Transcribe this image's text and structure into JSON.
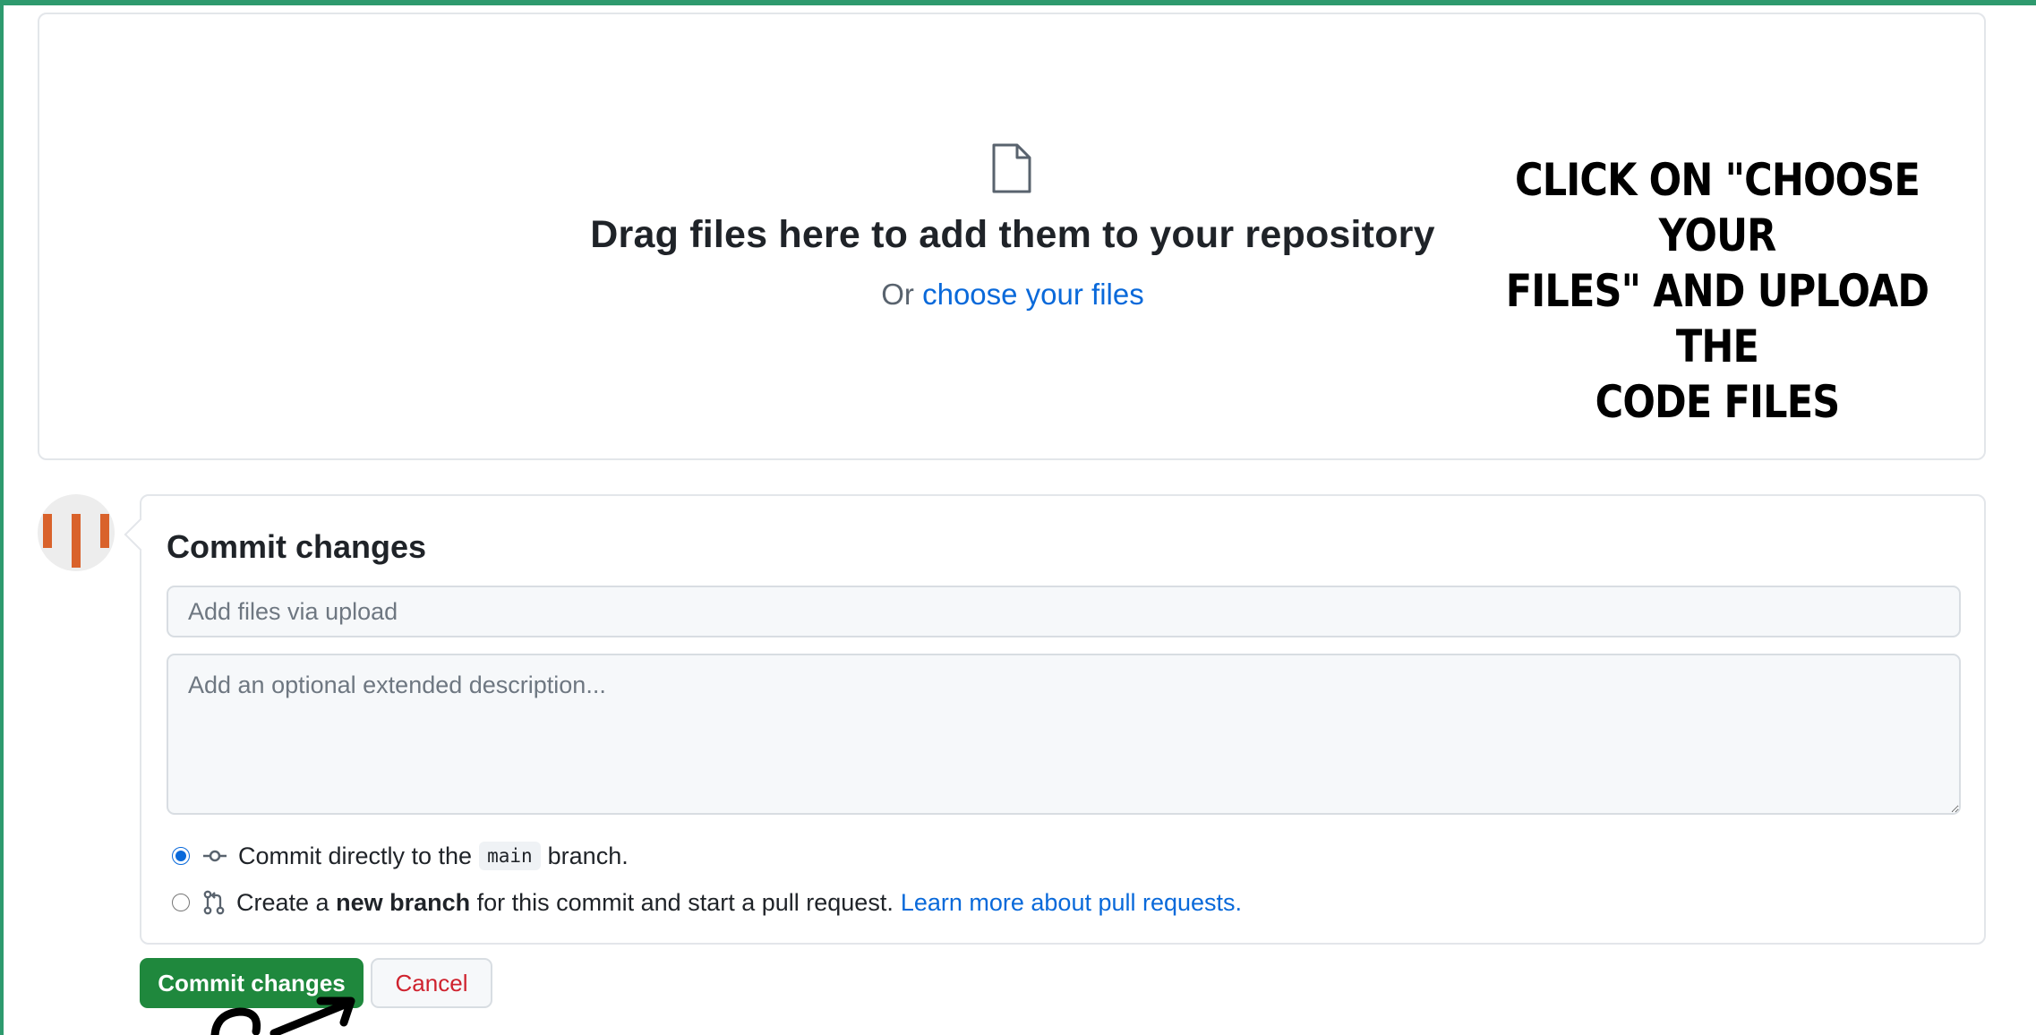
{
  "dropzone": {
    "icon": "file-icon",
    "title": "Drag files here to add them to your repository",
    "or_text": "Or",
    "choose_link": "choose your files"
  },
  "annotation": {
    "line1": "CLICK ON \"CHOOSE YOUR",
    "line2": "FILES\" AND UPLOAD THE",
    "line3": "CODE FILES"
  },
  "commit": {
    "title": "Commit changes",
    "summary_placeholder": "Add files via upload",
    "description_placeholder": "Add an optional extended description...",
    "option_direct": {
      "prefix": "Commit directly to the",
      "branch": "main",
      "suffix": "branch.",
      "selected": true
    },
    "option_new_branch": {
      "prefix": "Create a",
      "bold": "new branch",
      "suffix": "for this commit and start a pull request.",
      "link": "Learn more about pull requests.",
      "selected": false
    }
  },
  "buttons": {
    "commit": "Commit changes",
    "cancel": "Cancel"
  },
  "colors": {
    "accent_green": "#1f883d",
    "link_blue": "#0969da",
    "danger_red": "#cf222e",
    "frame_green": "#2e9a6e",
    "avatar_orange": "#d9622b"
  }
}
